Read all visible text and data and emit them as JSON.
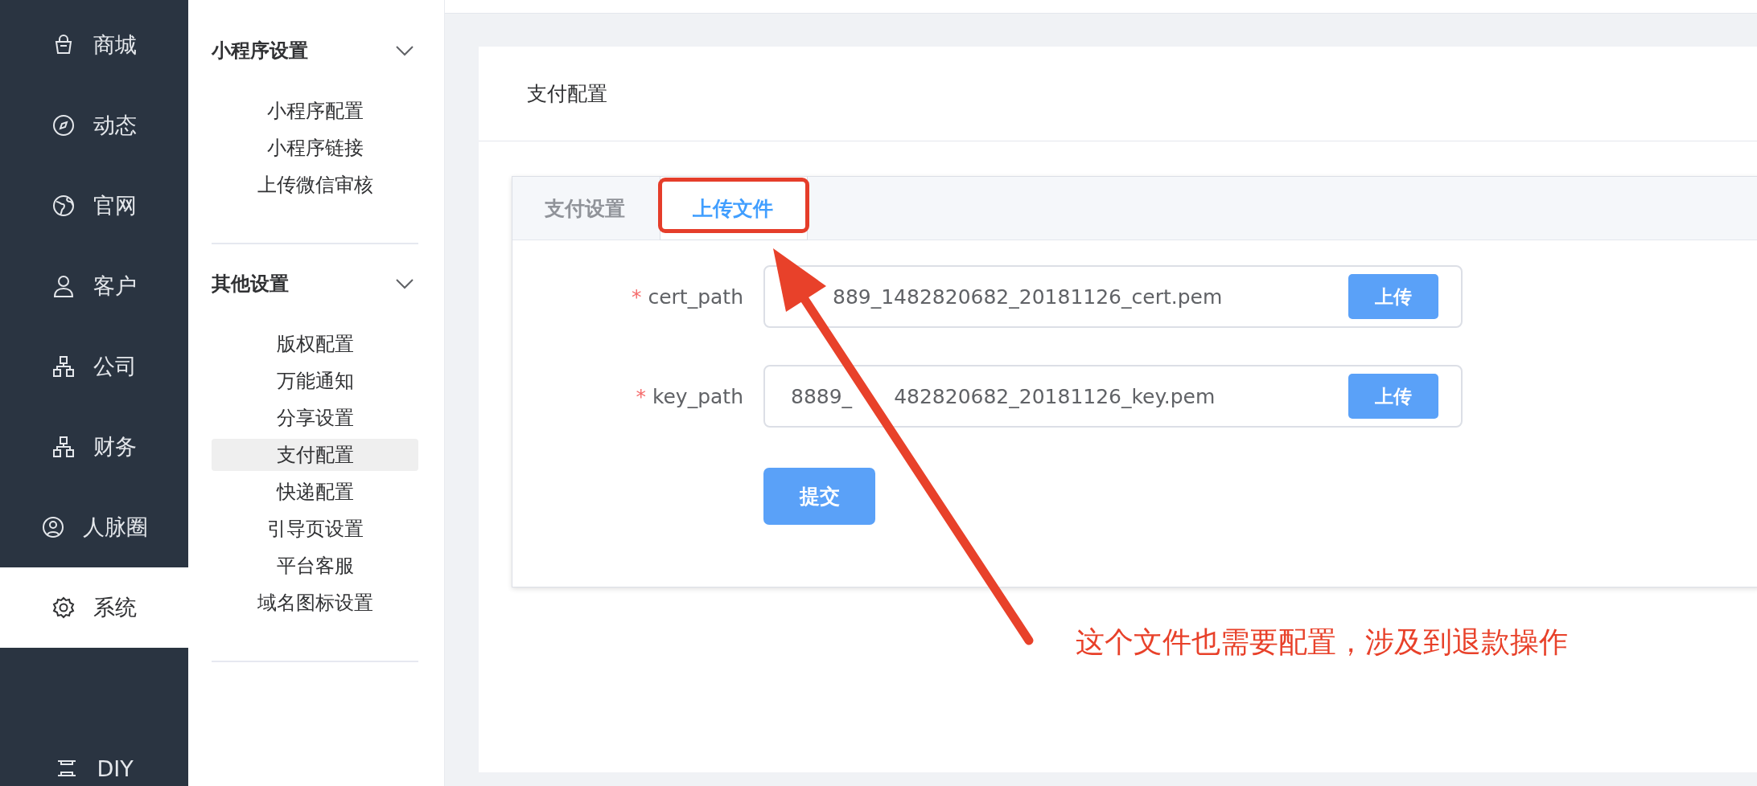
{
  "nav": [
    {
      "label": "商城",
      "kind": "bag",
      "selected": false
    },
    {
      "label": "动态",
      "kind": "compass",
      "selected": false
    },
    {
      "label": "官网",
      "kind": "globe",
      "selected": false
    },
    {
      "label": "客户",
      "kind": "user",
      "selected": false
    },
    {
      "label": "公司",
      "kind": "org",
      "selected": false
    },
    {
      "label": "财务",
      "kind": "org",
      "selected": false
    },
    {
      "label": "人脉圈",
      "kind": "user-circle",
      "selected": false
    },
    {
      "label": "系统",
      "kind": "gear",
      "selected": true
    },
    {
      "label": "DIY",
      "kind": "diy",
      "selected": false
    }
  ],
  "submenu": [
    {
      "title": "小程序设置",
      "expanded": true,
      "items": [
        {
          "label": "小程序配置",
          "selected": false
        },
        {
          "label": "小程序链接",
          "selected": false
        },
        {
          "label": "上传微信审核",
          "selected": false
        }
      ]
    },
    {
      "title": "其他设置",
      "expanded": true,
      "items": [
        {
          "label": "版权配置",
          "selected": false
        },
        {
          "label": "万能通知",
          "selected": false
        },
        {
          "label": "分享设置",
          "selected": false
        },
        {
          "label": "支付配置",
          "selected": true
        },
        {
          "label": "快递配置",
          "selected": false
        },
        {
          "label": "引导页设置",
          "selected": false
        },
        {
          "label": "平台客服",
          "selected": false
        },
        {
          "label": "域名图标设置",
          "selected": false
        }
      ]
    }
  ],
  "card": {
    "title": "支付配置",
    "tabs": [
      {
        "label": "支付设置",
        "selected": false,
        "circled": false
      },
      {
        "label": "上传文件",
        "selected": true,
        "circled": true
      }
    ],
    "fields": [
      {
        "required_mark": "*",
        "label": "cert_path",
        "value_parts": [
          {
            "text": "889_1482820682_20181126_cert.pem",
            "covered_before": true
          }
        ],
        "button": "上传"
      },
      {
        "required_mark": "*",
        "label": "key_path",
        "value_parts": [
          {
            "text": "8889_",
            "covered_before": false
          },
          {
            "text": "482820682_20181126_key.pem",
            "covered_before": true
          }
        ],
        "button": "上传"
      }
    ],
    "submit": "提交"
  },
  "annotation": {
    "text": "这个文件也需要配置，涉及到退款操作"
  }
}
